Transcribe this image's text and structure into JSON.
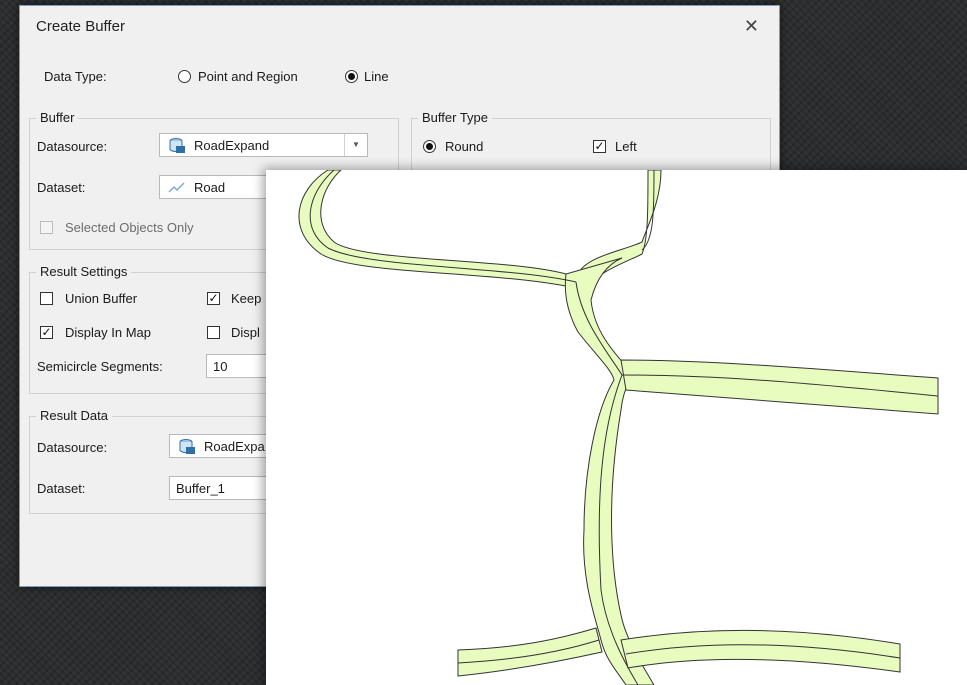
{
  "dialog": {
    "title": "Create Buffer",
    "close_label": "✕",
    "data_type_label": "Data Type:",
    "data_type_options": [
      "Point and Region",
      "Line"
    ],
    "buffer_group": {
      "title": "Buffer",
      "datasource_label": "Datasource:",
      "datasource_value": "RoadExpand",
      "dataset_label": "Dataset:",
      "dataset_value": "Road",
      "selected_only_label": "Selected Objects Only"
    },
    "buffer_type_group": {
      "title": "Buffer Type",
      "round_label": "Round",
      "left_label": "Left"
    },
    "result_settings_group": {
      "title": "Result Settings",
      "union_buffer_label": "Union Buffer",
      "keep_label": "Keep",
      "display_in_map_label": "Display In Map",
      "display_label": "Displ",
      "semicircle_label": "Semicircle Segments:",
      "semicircle_value": "10"
    },
    "result_data_group": {
      "title": "Result Data",
      "datasource_label": "Datasource:",
      "datasource_value": "RoadExpa",
      "dataset_label": "Dataset:",
      "dataset_value": "Buffer_1"
    }
  },
  "map": {
    "buffer_fill": "#e8fcc0",
    "stroke": "#333333"
  },
  "colors": {
    "dialog_bg": "#f0f0f0",
    "desktop_bg": "#2b2d2f"
  }
}
